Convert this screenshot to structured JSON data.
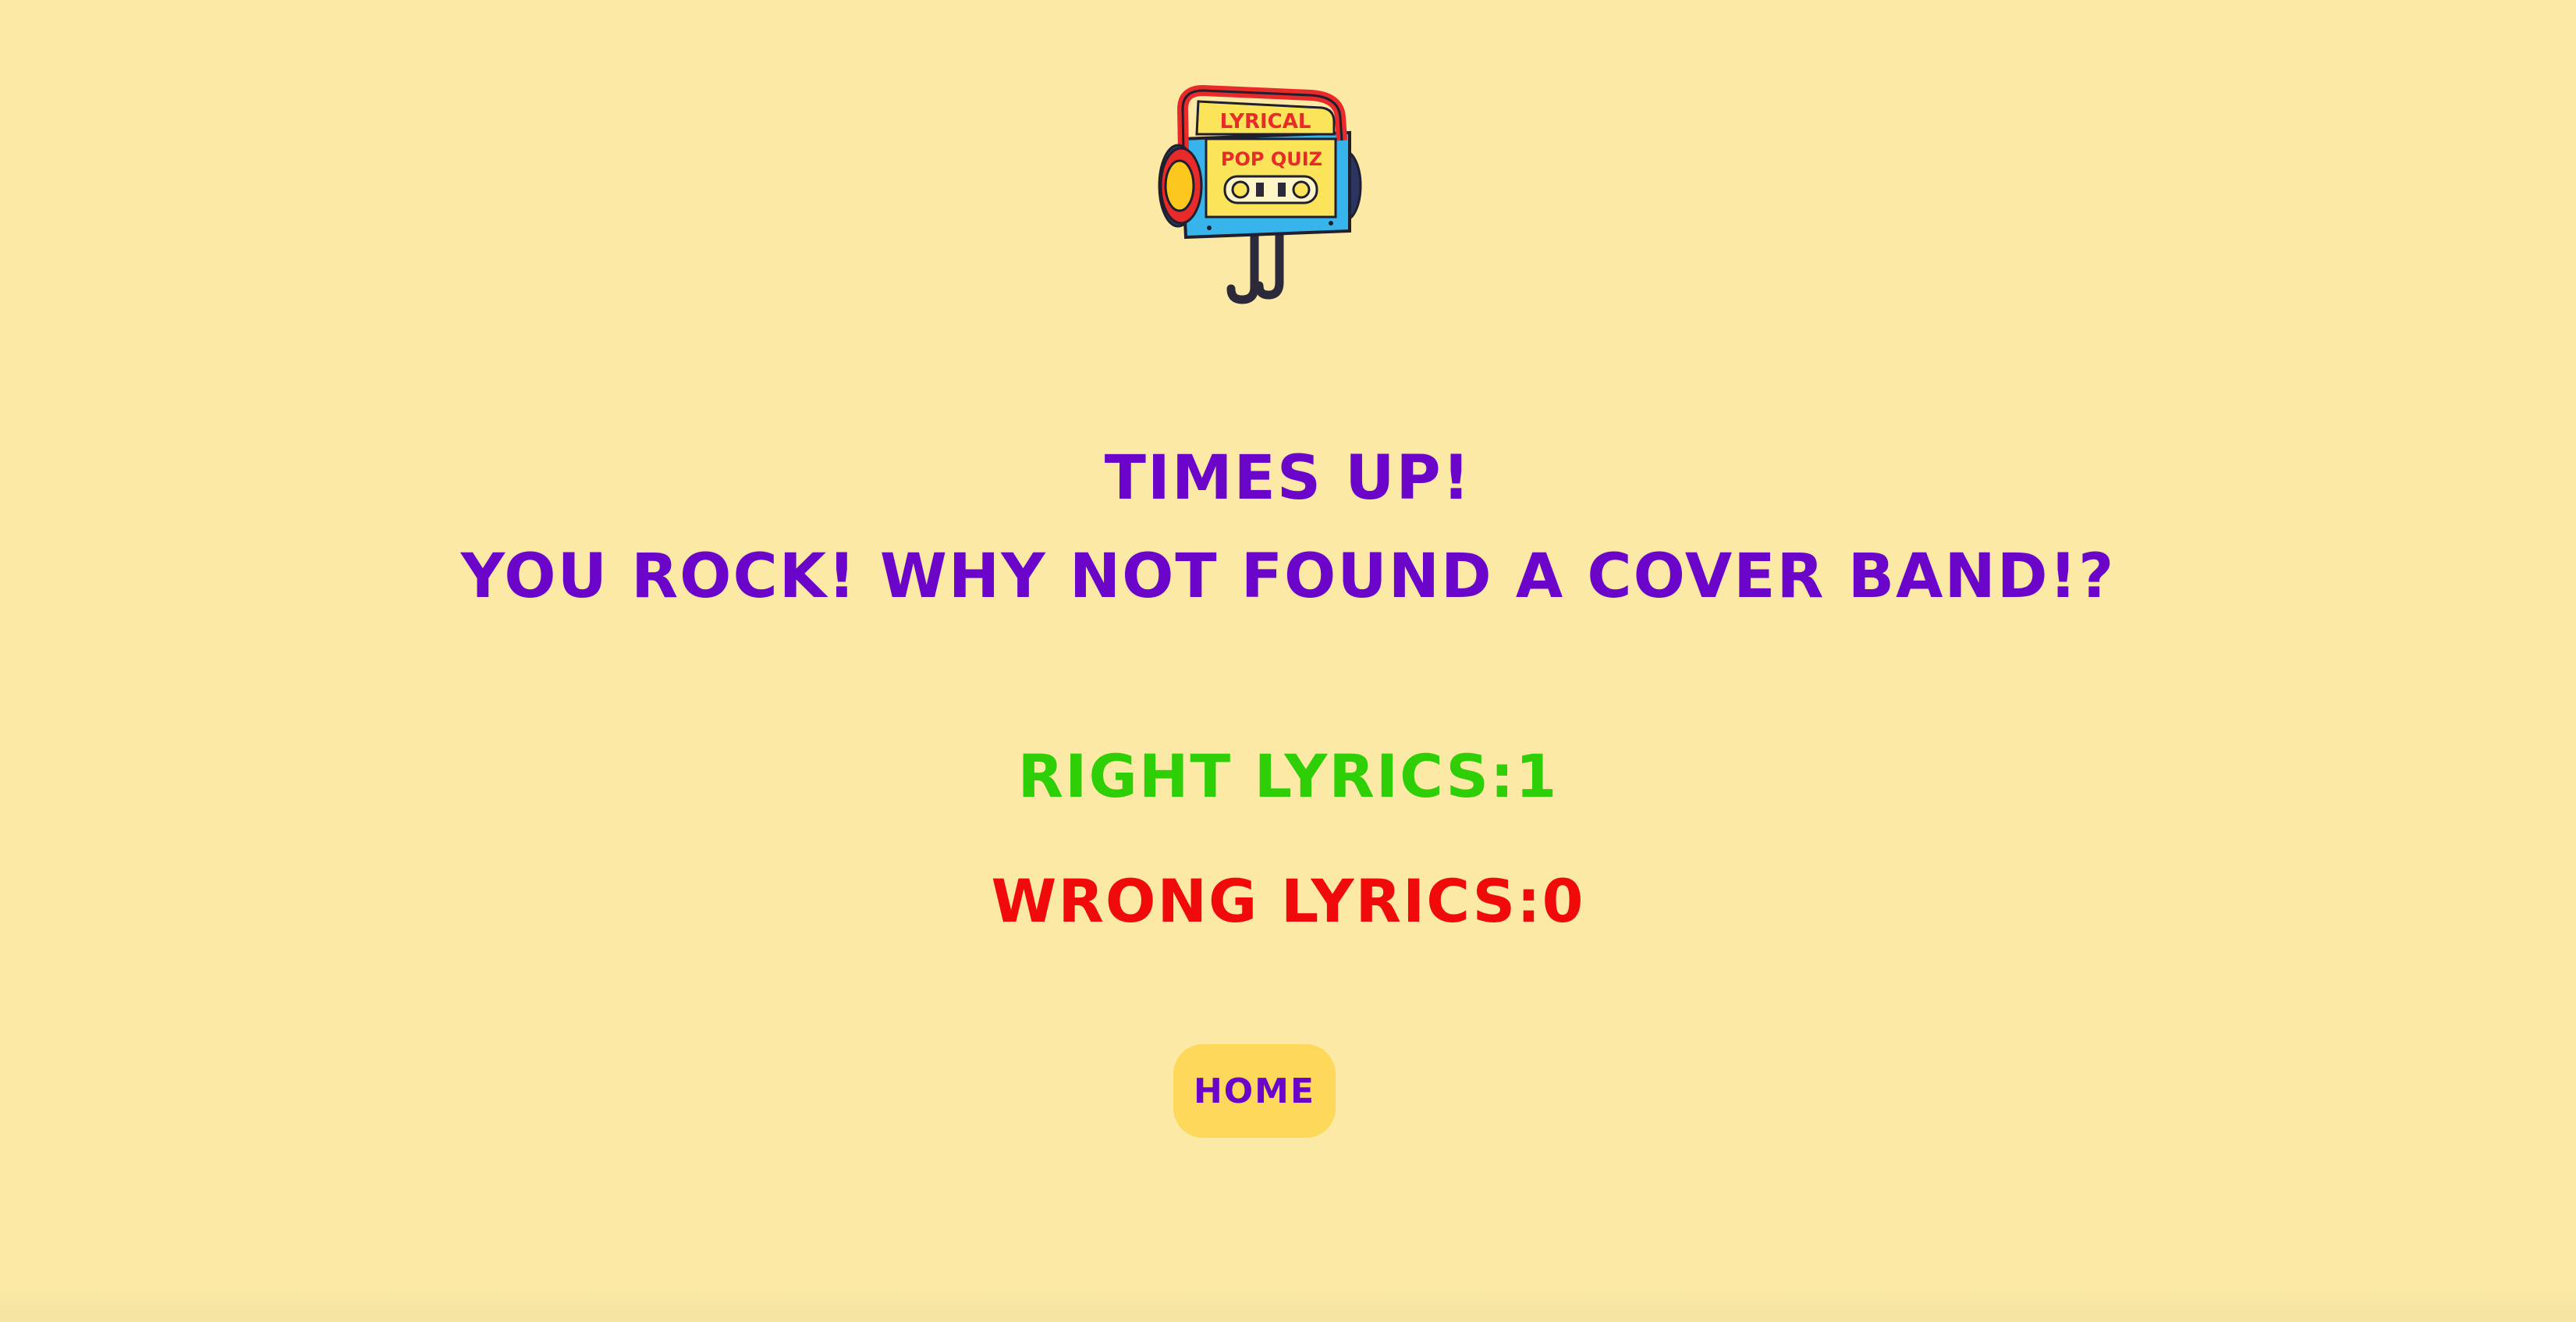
{
  "logo": {
    "line1": "LYRICAL",
    "line2": "POP QUIZ"
  },
  "result": {
    "heading": "TIMES UP!",
    "message": "YOU ROCK! WHY NOT FOUND A COVER BAND!?",
    "right_label": "RIGHT LYRICS:1",
    "wrong_label": "WRONG LYRICS:0"
  },
  "nav": {
    "home_label": "HOME"
  },
  "colors": {
    "background": "#fce9a6",
    "heading": "#6a05c9",
    "right": "#2fcf08",
    "wrong": "#f00a0a",
    "button": "#fdd85a"
  }
}
